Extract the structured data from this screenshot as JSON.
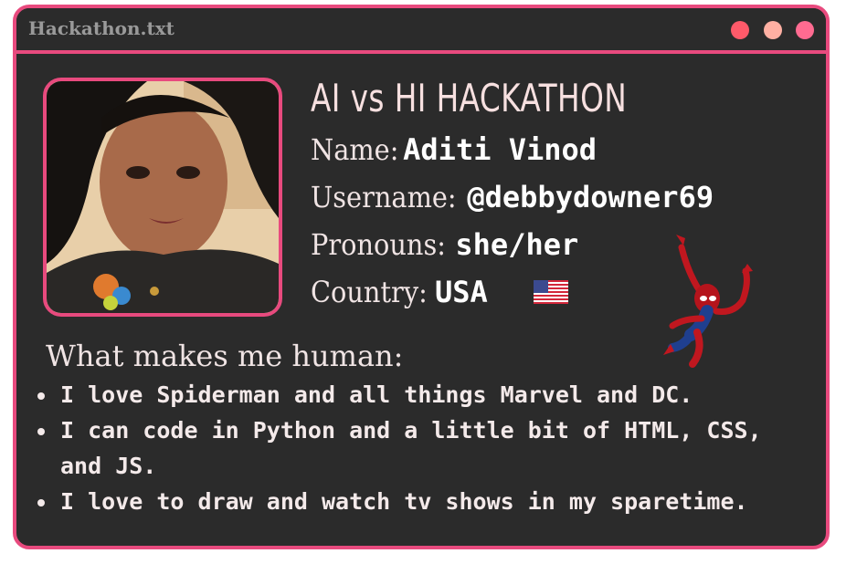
{
  "window": {
    "title": "Hackathon.txt",
    "border_color": "#e84a7e",
    "background_color": "#2b2b2b",
    "controls": [
      {
        "name": "close",
        "color": "#ff5a6a"
      },
      {
        "name": "minimize",
        "color": "#ffb0a3"
      },
      {
        "name": "maximize",
        "color": "#ff6b91"
      }
    ]
  },
  "profile": {
    "heading": "AI vs HI HACKATHON",
    "name_label": "Name:",
    "name_value": "Aditi Vinod",
    "username_label": "Username:",
    "username_value": "@debbydowner69",
    "pronouns_label": "Pronouns:",
    "pronouns_value": "she/her",
    "country_label": "Country:",
    "country_value": "USA",
    "flag_icon": "us-flag-icon",
    "sticker_icon": "spiderman-icon"
  },
  "about": {
    "title": "What makes me human:",
    "items": [
      "I love Spiderman and all things Marvel and DC.",
      "I can code in Python and a little bit of HTML, CSS, and JS.",
      "I love to draw and watch tv shows in my sparetime."
    ]
  }
}
